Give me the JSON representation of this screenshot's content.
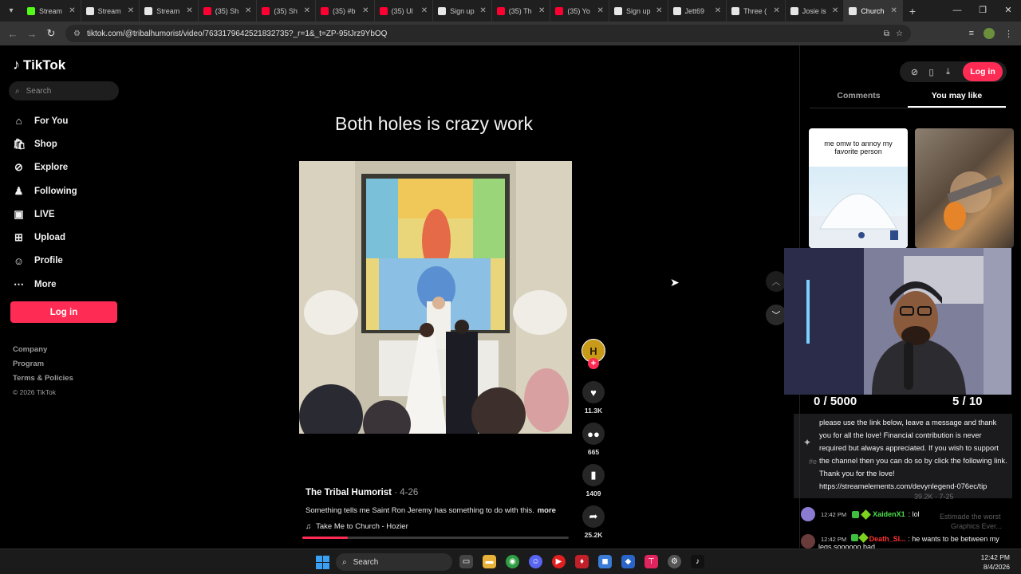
{
  "browser": {
    "tabs": [
      {
        "title": "Stream",
        "color": "#53fc18"
      },
      {
        "title": "Stream",
        "color": "#e6e6e6"
      },
      {
        "title": "Stream",
        "color": "#e6e6e6"
      },
      {
        "title": "(35) Sh",
        "color": "#ff0033"
      },
      {
        "title": "(35) Sh",
        "color": "#ff0033"
      },
      {
        "title": "(35) #b",
        "color": "#ff0033"
      },
      {
        "title": "(35) Ul",
        "color": "#ff0033"
      },
      {
        "title": "Sign up",
        "color": "#e6e6e6"
      },
      {
        "title": "(35) Th",
        "color": "#ff0033"
      },
      {
        "title": "(35) Yo",
        "color": "#ff0033"
      },
      {
        "title": "Sign up",
        "color": "#e6e6e6"
      },
      {
        "title": "Jett69",
        "color": "#e6e6e6"
      },
      {
        "title": "Three (",
        "color": "#e6e6e6"
      },
      {
        "title": "Josie is",
        "color": "#e6e6e6"
      },
      {
        "title": "Church",
        "color": "#e6e6e6",
        "active": true
      }
    ],
    "url": "tiktok.com/@tribalhumorist/video/7633179642521832735?_r=1&_t=ZP-95tJrz9YbOQ"
  },
  "sidebar": {
    "logo": "TikTok",
    "search_placeholder": "Search",
    "nav": [
      {
        "label": "For You",
        "icon": "home-icon"
      },
      {
        "label": "Shop",
        "icon": "shop-icon"
      },
      {
        "label": "Explore",
        "icon": "compass-icon"
      },
      {
        "label": "Following",
        "icon": "following-icon"
      },
      {
        "label": "LIVE",
        "icon": "live-icon"
      },
      {
        "label": "Upload",
        "icon": "upload-icon"
      },
      {
        "label": "Profile",
        "icon": "profile-icon"
      },
      {
        "label": "More",
        "icon": "more-icon"
      }
    ],
    "login_label": "Log in",
    "footer": [
      "Company",
      "Program",
      "Terms & Policies"
    ],
    "copyright": "© 2026 TikTok"
  },
  "video": {
    "caption_title": "Both holes is crazy work",
    "author": "The Tribal Humorist",
    "date": " · 4-26",
    "description": "Something tells me Saint Ron Jeremy has something to do with this.",
    "more_label": "more",
    "music": "Take Me to Church - Hozier",
    "progress": 0.17,
    "likes": "11.3K",
    "comments": "665",
    "saves": "1409",
    "shares": "25.2K",
    "avatar_initial": "H"
  },
  "right_panel": {
    "login_label": "Log in",
    "tabs": [
      "Comments",
      "You may like"
    ],
    "active_tab": 1,
    "thumb1_text": "me omw to annoy my favorite person"
  },
  "stream_overlay": {
    "stat_left": "0 / 5000",
    "stat_right": "5 / 10",
    "pinned_message": "please use the link below, leave a message and thank you for all the love! Financial contribution is never required but always appreciated. If you wish to support the channel then you can do so by click the following link. Thank you for the love! https://streamelements.com/devynlegend-076ec/tip",
    "ghost_1": "#e",
    "ghost_2": "39.2K · 7-25",
    "ghost_3": "Estimade the worst",
    "ghost_4": "Graphics Ever...",
    "chat": [
      {
        "time": "12:42 PM",
        "user": "XaidenX1",
        "text": ": lol",
        "user_color": "green"
      },
      {
        "time": "12:42 PM",
        "user": "Death_Sl...",
        "text": ": he wants to be between my legs soooooo bad",
        "user_color": "red"
      }
    ]
  },
  "taskbar": {
    "search_label": "Search",
    "time": "12:42 PM",
    "date": "8/4/2026"
  }
}
